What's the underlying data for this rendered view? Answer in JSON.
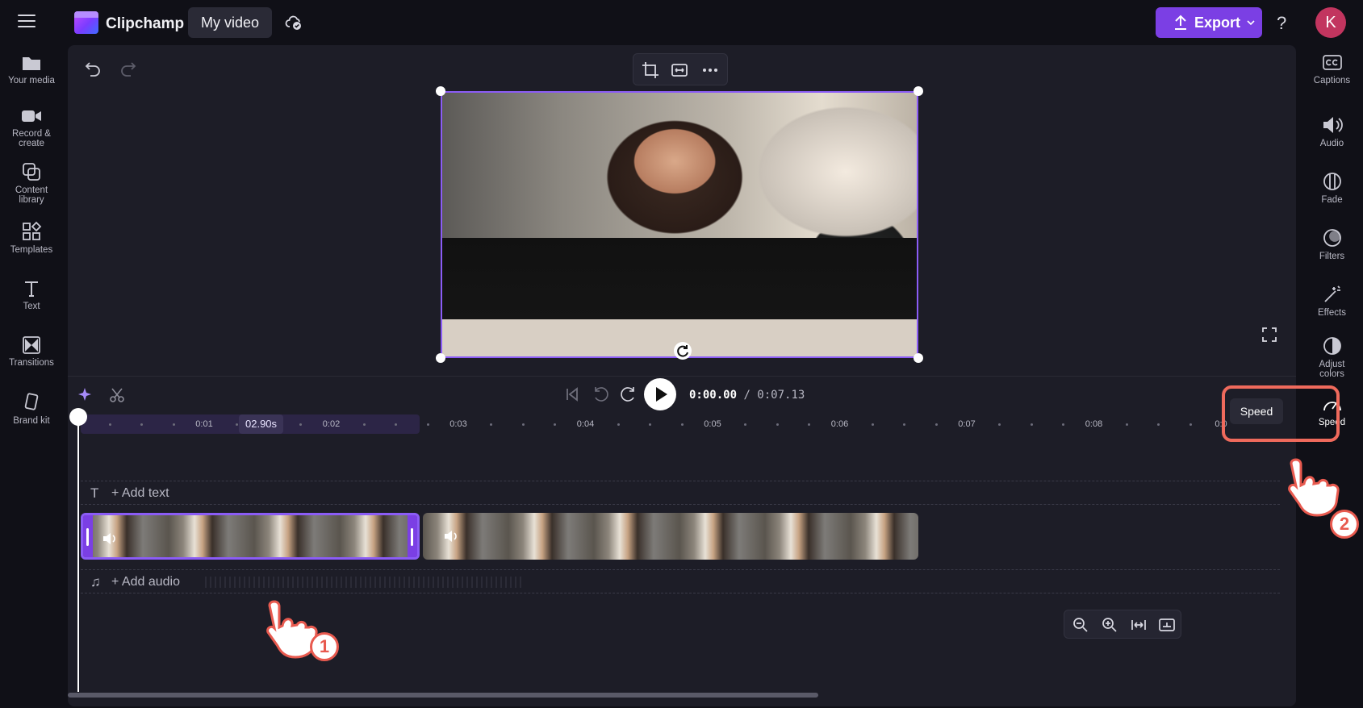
{
  "app": {
    "name": "Clipchamp",
    "project_name": "My video",
    "export_label": "Export",
    "avatar_initial": "K"
  },
  "left_sidebar": [
    {
      "label": "Your media",
      "icon": "folder-icon"
    },
    {
      "label": "Record & create",
      "icon": "camera-icon"
    },
    {
      "label": "Content library",
      "icon": "content-library-icon"
    },
    {
      "label": "Templates",
      "icon": "templates-icon"
    },
    {
      "label": "Text",
      "icon": "text-icon"
    },
    {
      "label": "Transitions",
      "icon": "transitions-icon"
    },
    {
      "label": "Brand kit",
      "icon": "brand-kit-icon"
    }
  ],
  "right_sidebar": [
    {
      "label": "Captions",
      "icon": "captions-icon"
    },
    {
      "label": "Audio",
      "icon": "speaker-icon"
    },
    {
      "label": "Fade",
      "icon": "fade-icon"
    },
    {
      "label": "Filters",
      "icon": "filters-icon"
    },
    {
      "label": "Effects",
      "icon": "magic-wand-icon"
    },
    {
      "label": "Adjust colors",
      "icon": "adjust-colors-icon"
    },
    {
      "label": "Speed",
      "icon": "speedometer-icon"
    }
  ],
  "playback": {
    "current_time": "0:00.00",
    "total_time": "/ 0:07.13",
    "skip_seconds": "5"
  },
  "ruler": {
    "ticks": [
      "0:01",
      "0:02",
      "0:03",
      "0:04",
      "0:05",
      "0:06",
      "0:07",
      "0:08",
      "0:0"
    ],
    "speed_chip": "02.90s"
  },
  "tracks": {
    "add_text": "+ Add text",
    "add_audio": "+ Add audio"
  },
  "tooltip": {
    "speed": "Speed"
  },
  "annotations": {
    "step1": "1",
    "step2": "2"
  },
  "colors": {
    "accent": "#7b3fe4",
    "selection": "#8b5cf6",
    "highlight": "#ef6a5c"
  }
}
